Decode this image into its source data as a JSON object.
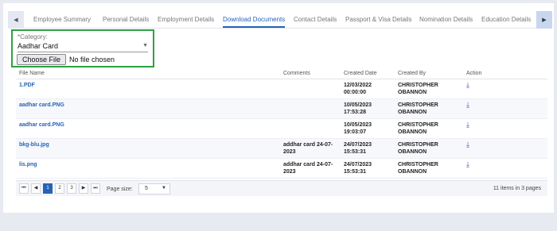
{
  "tabs": [
    {
      "label": "Employee Summary",
      "active": false
    },
    {
      "label": "Personal Details",
      "active": false
    },
    {
      "label": "Employment Details",
      "active": false
    },
    {
      "label": "Download Documents",
      "active": true
    },
    {
      "label": "Contact Details",
      "active": false
    },
    {
      "label": "Passport & Visa Details",
      "active": false
    },
    {
      "label": "Nomination Details",
      "active": false
    },
    {
      "label": "Education Details",
      "active": false
    }
  ],
  "category": {
    "label": "*Category:",
    "value": "Aadhar Card",
    "choose_file_label": "Choose File",
    "file_status": "No file chosen"
  },
  "grid": {
    "headers": [
      "File Name",
      "Comments",
      "Created Date",
      "Created By",
      "Action"
    ],
    "rows": [
      {
        "file": "1.PDF",
        "comments": "",
        "date1": "12/03/2022",
        "date2": "00:00:00",
        "by1": "CHRISTOPHER",
        "by2": "OBANNON"
      },
      {
        "file": "aadhar card.PNG",
        "comments": "",
        "date1": "10/05/2023",
        "date2": "17:53:28",
        "by1": "CHRISTOPHER",
        "by2": "OBANNON"
      },
      {
        "file": "aadhar card.PNG",
        "comments": "",
        "date1": "10/05/2023",
        "date2": "19:03:07",
        "by1": "CHRISTOPHER",
        "by2": "OBANNON"
      },
      {
        "file": "bkg-blu.jpg",
        "comments1": "addhar card 24-07-",
        "comments2": "2023",
        "date1": "24/07/2023",
        "date2": "15:53:31",
        "by1": "CHRISTOPHER",
        "by2": "OBANNON"
      },
      {
        "file": "lis.png",
        "comments1": "addhar card 24-07-",
        "comments2": "2023",
        "date1": "24/07/2023",
        "date2": "15:53:31",
        "by1": "CHRISTOPHER",
        "by2": "OBANNON"
      }
    ]
  },
  "pager": {
    "first": "⏮",
    "prev": "◀",
    "pages": [
      "1",
      "2",
      "3"
    ],
    "next": "▶",
    "last": "⏭",
    "page_size_label": "Page size:",
    "page_size_value": "5",
    "info": "11 items in 3 pages"
  },
  "icons": {
    "left_arrow": "◀",
    "right_arrow": "▶",
    "download": "⤓",
    "chevron": "▼"
  },
  "colors": {
    "accent": "#2563b8",
    "highlight_border": "#2ea043"
  }
}
